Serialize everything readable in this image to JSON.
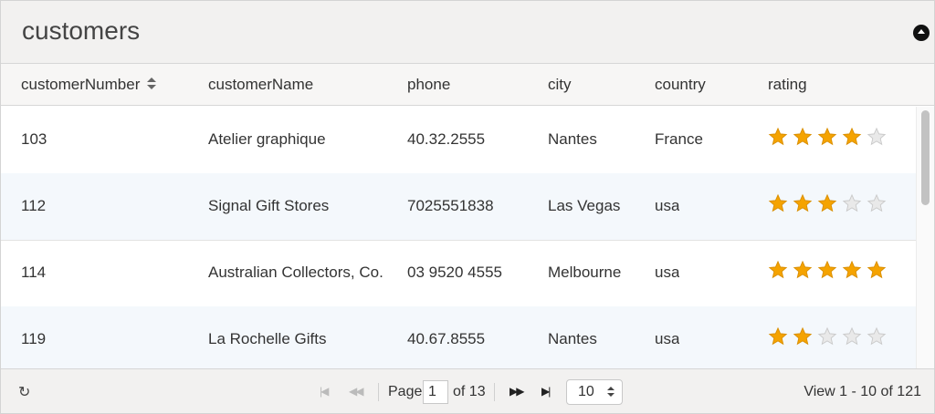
{
  "caption": {
    "title": "customers"
  },
  "columns": [
    {
      "key": "customerNumber",
      "label": "customerNumber"
    },
    {
      "key": "customerName",
      "label": "customerName"
    },
    {
      "key": "phone",
      "label": "phone"
    },
    {
      "key": "city",
      "label": "city"
    },
    {
      "key": "country",
      "label": "country"
    },
    {
      "key": "rating",
      "label": "rating"
    }
  ],
  "rows": [
    {
      "customerNumber": "103",
      "customerName": "Atelier graphique",
      "phone": "40.32.2555",
      "city": "Nantes",
      "country": "France",
      "rating": 4
    },
    {
      "customerNumber": "112",
      "customerName": "Signal Gift Stores",
      "phone": "7025551838",
      "city": "Las Vegas",
      "country": "usa",
      "rating": 3
    },
    {
      "customerNumber": "114",
      "customerName": "Australian Collectors, Co.",
      "phone": "03 9520 4555",
      "city": "Melbourne",
      "country": "usa",
      "rating": 5
    },
    {
      "customerNumber": "119",
      "customerName": "La Rochelle Gifts",
      "phone": "40.67.8555",
      "city": "Nantes",
      "country": "usa",
      "rating": 2
    }
  ],
  "rating_max": 5,
  "colors": {
    "star_on": "#f5a300",
    "star_off": "#e9e9e9",
    "alt_row": "#f4f8fc"
  },
  "pager": {
    "page_label": "Page",
    "page_value": "1",
    "of_label": "of 13",
    "rows_per_page": "10",
    "view_info": "View 1 - 10 of 121",
    "first_icon": "first-page-icon",
    "prev_icon": "prev-page-icon",
    "next_icon": "next-page-icon",
    "last_icon": "last-page-icon",
    "refresh_icon": "refresh-icon"
  }
}
